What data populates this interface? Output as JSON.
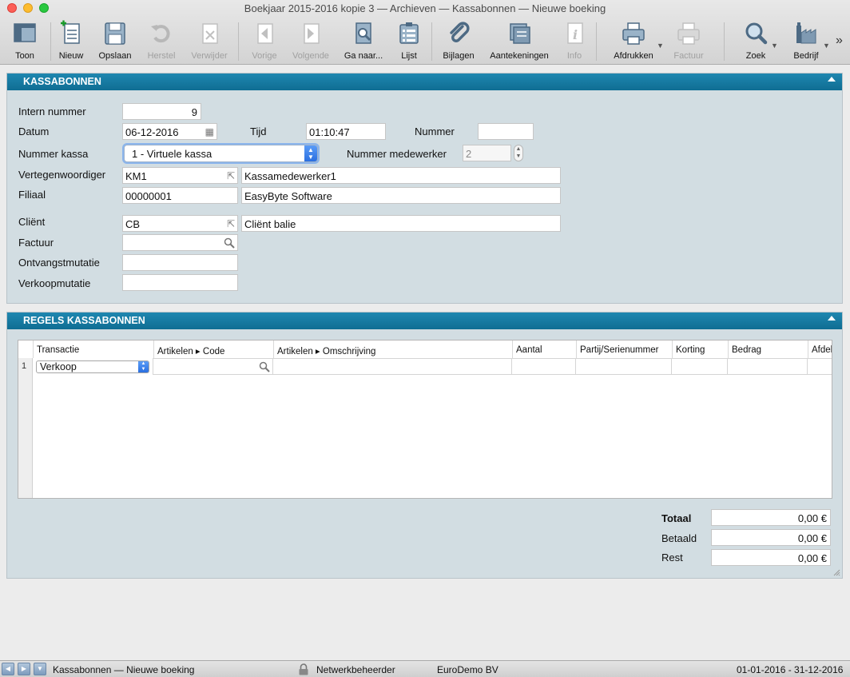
{
  "window": {
    "title": "Boekjaar 2015-2016 kopie 3 — Archieven — Kassabonnen — Nieuwe boeking"
  },
  "toolbar": {
    "toon": "Toon",
    "nieuw": "Nieuw",
    "opslaan": "Opslaan",
    "herstel": "Herstel",
    "verwijder": "Verwijder",
    "vorige": "Vorige",
    "volgende": "Volgende",
    "ganaar": "Ga naar...",
    "lijst": "Lijst",
    "bijlagen": "Bijlagen",
    "aantekeningen": "Aantekeningen",
    "info": "Info",
    "afdrukken": "Afdrukken",
    "factuur": "Factuur",
    "zoek": "Zoek",
    "bedrijf": "Bedrijf",
    "more": "»"
  },
  "kassabonnen": {
    "title": "KASSABONNEN",
    "labels": {
      "intern_nummer": "Intern nummer",
      "datum": "Datum",
      "tijd": "Tijd",
      "nummer": "Nummer",
      "nummer_kassa": "Nummer kassa",
      "nummer_medewerker": "Nummer medewerker",
      "vertegenwoordiger": "Vertegenwoordiger",
      "filiaal": "Filiaal",
      "client": "Cliënt",
      "factuur": "Factuur",
      "ontvangstmutatie": "Ontvangstmutatie",
      "verkoopmutatie": "Verkoopmutatie"
    },
    "values": {
      "intern_nummer": "9",
      "datum": "06-12-2016",
      "tijd": "01:10:47",
      "nummer": "",
      "nummer_kassa": "1 - Virtuele kassa",
      "nummer_medewerker": "2",
      "vertegenwoordiger_code": "KM1",
      "vertegenwoordiger_naam": "Kassamedewerker1",
      "filiaal_code": "00000001",
      "filiaal_naam": "EasyByte Software",
      "client_code": "CB",
      "client_naam": "Cliënt balie",
      "factuur": "",
      "ontvangstmutatie": "",
      "verkoopmutatie": ""
    }
  },
  "regels": {
    "title": "REGELS KASSABONNEN",
    "columns": [
      "Transactie",
      "Artikelen ▸ Code",
      "Artikelen ▸ Omschrijving",
      "Aantal",
      "Partij/Serienummer",
      "Korting",
      "Bedrag",
      "Afdel"
    ],
    "rows": [
      {
        "num": "1",
        "transactie": "Verkoop",
        "code": "",
        "omschrijving": "",
        "aantal": "",
        "partij": "",
        "korting": "",
        "bedrag": ""
      }
    ]
  },
  "totals": {
    "totaal_label": "Totaal",
    "totaal": "0,00 €",
    "betaald_label": "Betaald",
    "betaald": "0,00 €",
    "rest_label": "Rest",
    "rest": "0,00 €"
  },
  "statusbar": {
    "context": "Kassabonnen — Nieuwe boeking",
    "user": "Netwerkbeheerder",
    "company": "EuroDemo BV",
    "period": "01-01-2016 - 31-12-2016"
  }
}
